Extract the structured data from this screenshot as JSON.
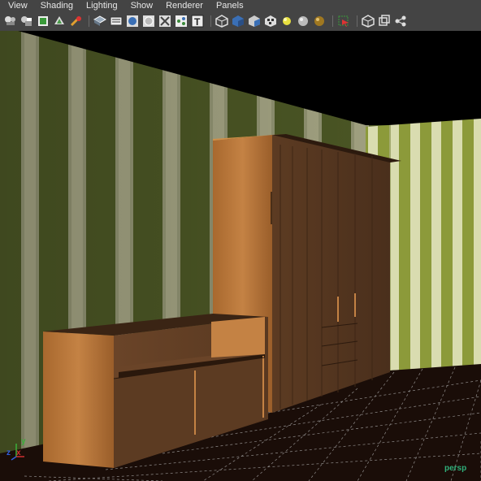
{
  "menu": {
    "items": [
      "View",
      "Shading",
      "Lighting",
      "Show",
      "Renderer",
      "Panels"
    ]
  },
  "toolbar": {
    "groups": [
      [
        "camera-attributes-icon",
        "camera-bookmark-icon",
        "image-plane-icon",
        "two-d-pan-zoom-icon",
        "grease-pencil-icon"
      ],
      [
        "wireframe-icon",
        "smooth-shade-icon",
        "default-material-icon",
        "xray-icon",
        "xray-joints-icon",
        "xray-components-icon",
        "textured-icon"
      ],
      [
        "wireframe-on-shaded-icon",
        "use-default-material-icon",
        "shadows-icon",
        "checker-icon",
        "use-lights-icon",
        "default-light-icon",
        "all-lights-icon"
      ],
      [
        "isolate-select-icon"
      ],
      [
        "resolution-gate-icon",
        "film-gate-icon",
        "field-chart-icon"
      ]
    ]
  },
  "viewport": {
    "camera_label": "persp",
    "axis": {
      "x": "x",
      "y": "y",
      "z": "z"
    }
  },
  "colors": {
    "ui_gray": "#444444",
    "menu_text": "#e8e8e8",
    "camera_label": "#2fb07a",
    "wallpaper_green": "#4f5a28",
    "wallpaper_beige": "#9a9a78",
    "wood_light": "#b5763c",
    "wood_dark": "#5a3a22",
    "floor": "#1a0d08"
  }
}
